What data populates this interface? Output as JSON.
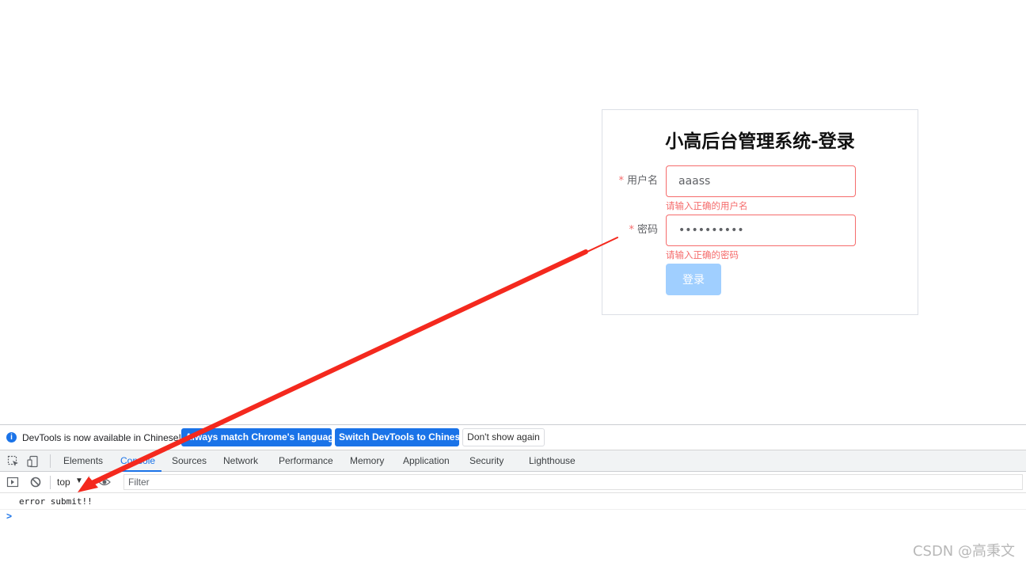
{
  "login": {
    "title": "小高后台管理系统-登录",
    "required_mark": "*",
    "username_label": "用户名",
    "username_value": "aaass",
    "username_error": "请输入正确的用户名",
    "password_label": "密码",
    "password_value": "••••••••••",
    "password_error": "请输入正确的密码",
    "submit_label": "登录"
  },
  "devtools": {
    "info_text": "DevTools is now available in Chinese!",
    "btn_always_match": "Always match Chrome's language",
    "btn_switch": "Switch DevTools to Chinese",
    "btn_dont_show": "Don't show again",
    "tabs": [
      "Elements",
      "Console",
      "Sources",
      "Network",
      "Performance",
      "Memory",
      "Application",
      "Security",
      "Lighthouse"
    ],
    "active_tab": "Console",
    "context": "top",
    "filter_placeholder": "Filter",
    "console_message": "error submit!!",
    "prompt": ">"
  },
  "colors": {
    "error": "#f56c6c",
    "button": "#a0cfff",
    "devtools_accent": "#1a73e8",
    "annotation_arrow": "#f4291e"
  },
  "watermark": "CSDN @高秉文"
}
